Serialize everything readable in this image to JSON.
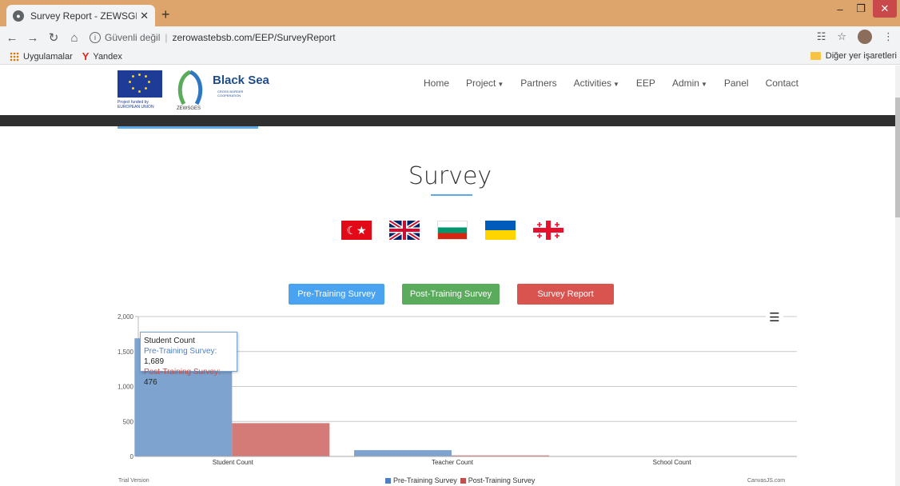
{
  "browser": {
    "tab_title": "Survey Report - ZEWSGES",
    "insecure_label": "Güvenli değil",
    "url": "zerowastebsb.com/EEP/SurveyReport",
    "bookmarks": {
      "apps": "Uygulamalar",
      "yandex": "Yandex",
      "other": "Diğer yer işaretleri"
    }
  },
  "logos": {
    "eu_caption_1": "Project funded by",
    "eu_caption_2": "EUROPEAN UNION",
    "zew_caption": "ZEWSGES",
    "blacksea_title": "Black Sea",
    "blacksea_sub_1": "CROSS BORDER",
    "blacksea_sub_2": "COOPERATION"
  },
  "nav": {
    "home": "Home",
    "project": "Project",
    "partners": "Partners",
    "activities": "Activities",
    "eep": "EEP",
    "admin": "Admin",
    "panel": "Panel",
    "contact": "Contact"
  },
  "page": {
    "title": "Survey",
    "languages": [
      "tr",
      "en",
      "bg",
      "ua",
      "ge"
    ]
  },
  "buttons": {
    "pre": "Pre-Training Survey",
    "post": "Post-Training Survey",
    "report": "Survey Report"
  },
  "colors": {
    "pre": "#7ea3cf",
    "post": "#d47b78",
    "pre_legend": "#4f7fc0",
    "post_legend": "#c0504d"
  },
  "chart_data": {
    "type": "bar",
    "categories": [
      "Student Count",
      "Teacher Count",
      "School Count"
    ],
    "series": [
      {
        "name": "Pre-Training Survey",
        "values": [
          1689,
          90,
          0
        ]
      },
      {
        "name": "Post-Training Survey",
        "values": [
          476,
          15,
          0
        ]
      }
    ],
    "y_ticks": [
      "0",
      "500",
      "1,000",
      "1,500",
      "2,000"
    ],
    "ylim": [
      0,
      2000
    ],
    "grid": true,
    "legend_position": "bottom-center"
  },
  "tooltip": {
    "title": "Student Count",
    "pre_label": "Pre-Training Survey:",
    "pre_value": "1,689",
    "post_label": "Post-Training Survey:",
    "post_value": "476"
  },
  "chart_footer": {
    "trial": "Trial Version",
    "credit": "CanvasJS.com"
  }
}
